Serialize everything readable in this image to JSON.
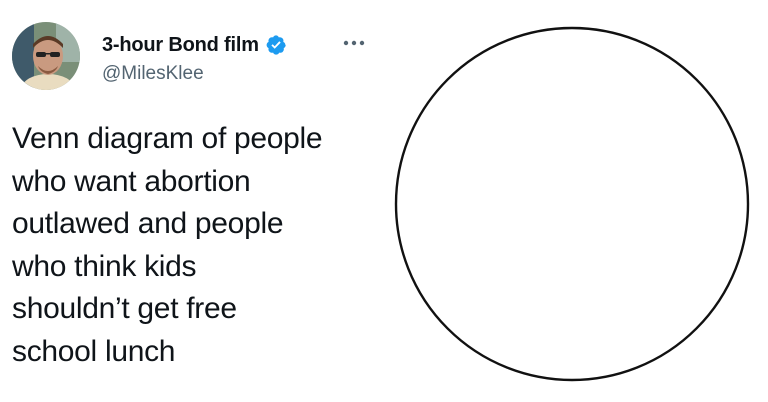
{
  "tweet": {
    "display_name": "3-hour Bond film",
    "handle": "@MilesKlee",
    "verified": true,
    "more_icon": "more-horizontal-icon",
    "text_lines": [
      "Venn diagram of people",
      "who want abortion",
      "outlawed and people",
      "who think kids",
      "shouldn’t get free",
      "school lunch"
    ]
  },
  "colors": {
    "verified_blue": "#1d9bf0",
    "handle_gray": "#536471",
    "text": "#0f1419"
  }
}
